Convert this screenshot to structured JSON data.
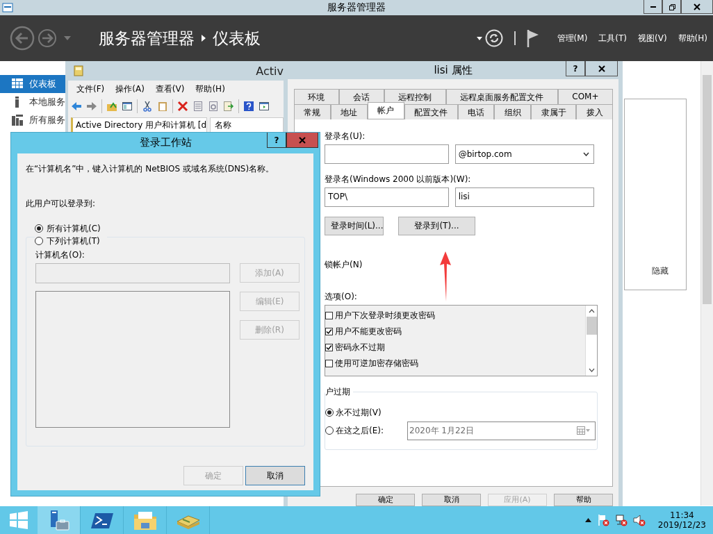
{
  "server_manager": {
    "title": "服务器管理器",
    "breadcrumb": [
      "服务器管理器",
      "仪表板"
    ],
    "menu": [
      "管理(M)",
      "工具(T)",
      "视图(V)",
      "帮助(H)"
    ],
    "sidebar": [
      {
        "label": "仪表板",
        "selected": true
      },
      {
        "label": "本地服务",
        "selected": false
      },
      {
        "label": "所有服务",
        "selected": false
      }
    ],
    "panel_text": "隐藏"
  },
  "ad_window": {
    "title": "Activ",
    "menu": [
      "文件(F)",
      "操作(A)",
      "查看(V)",
      "帮助(H)"
    ],
    "tree_item": "Active Directory 用户和计算机 [d",
    "column": "名称"
  },
  "properties_dialog": {
    "title": "lisi 属性",
    "help_label": "?",
    "tab_rows": [
      [
        {
          "label": "环境",
          "selected": false
        },
        {
          "label": "会话",
          "selected": false
        },
        {
          "label": "远程控制",
          "selected": false
        },
        {
          "label": "远程桌面服务配置文件",
          "selected": false
        },
        {
          "label": "COM+",
          "selected": false
        }
      ],
      [
        {
          "label": "常规",
          "selected": false
        },
        {
          "label": "地址",
          "selected": false
        },
        {
          "label": "帐户",
          "selected": true
        },
        {
          "label": "配置文件",
          "selected": false
        },
        {
          "label": "电话",
          "selected": false
        },
        {
          "label": "组织",
          "selected": false
        },
        {
          "label": "隶属于",
          "selected": false
        },
        {
          "label": "拨入",
          "selected": false
        }
      ]
    ],
    "logon_name_label": "登录名(U):",
    "domain": "@birtop.com",
    "pre2000_label": "登录名(Windows 2000 以前版本)(W):",
    "pre2000_domain": "TOP\\",
    "pre2000_user": "lisi",
    "action_buttons": [
      "登录时间(L)...",
      "登录到(T)..."
    ],
    "unlock_label": "锁帐户(N)",
    "options_label": "选项(O):",
    "options": [
      {
        "label": "用户下次登录时须更改密码",
        "checked": false
      },
      {
        "label": "用户不能更改密码",
        "checked": true
      },
      {
        "label": "密码永不过期",
        "checked": true
      },
      {
        "label": "使用可逆加密存储密码",
        "checked": false
      }
    ],
    "expiry_label": "户过期",
    "expiry_options": [
      {
        "label": "永不过期(V)",
        "selected": true
      },
      {
        "label": "在这之后(E):",
        "selected": false
      }
    ],
    "expiry_date": "2020年  1月22日",
    "buttons": [
      {
        "label": "确定",
        "disabled": false
      },
      {
        "label": "取消",
        "disabled": false
      },
      {
        "label": "应用(A)",
        "disabled": true
      },
      {
        "label": "帮助",
        "disabled": false
      }
    ]
  },
  "logon_dialog": {
    "title": "登录工作站",
    "help_label": "?",
    "instruction": "在“计算机名”中，键入计算机的 NetBIOS 或域名系统(DNS)名称。",
    "scope_label": "此用户可以登录到:",
    "scope_options": [
      {
        "label": "所有计算机(C)",
        "selected": true
      },
      {
        "label": "下列计算机(T)",
        "selected": false
      }
    ],
    "computer_name_label": "计算机名(O):",
    "side_buttons": [
      {
        "label": "添加(A)",
        "disabled": true
      },
      {
        "label": "编辑(E)",
        "disabled": true
      },
      {
        "label": "删除(R)",
        "disabled": true
      }
    ],
    "buttons": [
      {
        "label": "确定",
        "disabled": true
      },
      {
        "label": "取消",
        "disabled": false
      }
    ]
  },
  "taskbar": {
    "time": "11:34",
    "date": "2019/12/23"
  }
}
